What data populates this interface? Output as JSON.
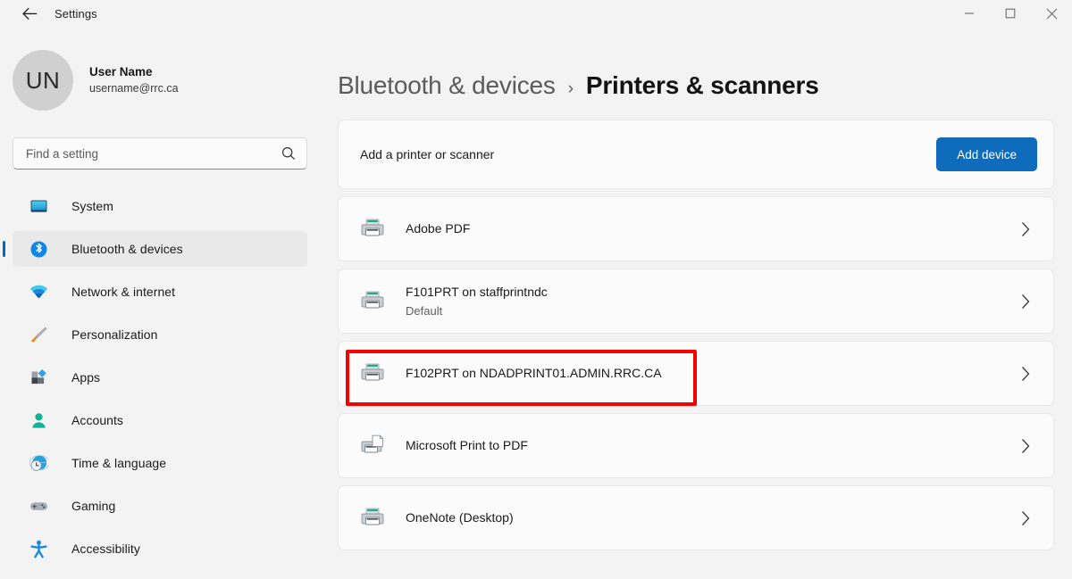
{
  "window": {
    "title": "Settings",
    "back_icon": "back-arrow-icon",
    "controls": [
      {
        "name": "minimize-button",
        "icon": "minimize-icon"
      },
      {
        "name": "maximize-button",
        "icon": "maximize-icon"
      },
      {
        "name": "close-button",
        "icon": "close-icon"
      }
    ]
  },
  "sidebar": {
    "account": {
      "initials": "UN",
      "name": "User Name",
      "email": "username@rrc.ca"
    },
    "search": {
      "placeholder": "Find a setting",
      "value": "",
      "icon": "search-icon"
    },
    "items": [
      {
        "label": "System",
        "icon": "system-icon",
        "active": false
      },
      {
        "label": "Bluetooth & devices",
        "icon": "bluetooth-icon",
        "active": true
      },
      {
        "label": "Network & internet",
        "icon": "wifi-icon",
        "active": false
      },
      {
        "label": "Personalization",
        "icon": "paintbrush-icon",
        "active": false
      },
      {
        "label": "Apps",
        "icon": "apps-icon",
        "active": false
      },
      {
        "label": "Accounts",
        "icon": "person-icon",
        "active": false
      },
      {
        "label": "Time & language",
        "icon": "clock-globe-icon",
        "active": false
      },
      {
        "label": "Gaming",
        "icon": "gamepad-icon",
        "active": false
      },
      {
        "label": "Accessibility",
        "icon": "accessibility-icon",
        "active": false
      }
    ]
  },
  "breadcrumb": {
    "parent": "Bluetooth & devices",
    "separator": "›",
    "current": "Printers & scanners"
  },
  "add_device": {
    "label": "Add a printer or scanner",
    "button_label": "Add device"
  },
  "printers": [
    {
      "name": "Adobe PDF",
      "status": "",
      "icon": "printer-icon",
      "highlighted": false
    },
    {
      "name": "F101PRT on staffprintndc",
      "status": "Default",
      "icon": "printer-icon",
      "highlighted": false
    },
    {
      "name": "F102PRT on NDADPRINT01.ADMIN.RRC.CA",
      "status": "",
      "icon": "printer-icon",
      "highlighted": true
    },
    {
      "name": "Microsoft Print to PDF",
      "status": "",
      "icon": "printer-document-icon",
      "highlighted": false
    },
    {
      "name": "OneNote (Desktop)",
      "status": "",
      "icon": "printer-icon",
      "highlighted": false
    }
  ],
  "colors": {
    "accent": "#0f6cbd",
    "accent_indicator": "#0067c0",
    "highlight": "#f80000",
    "page_bg": "#f3f3f3",
    "card_bg": "#fbfbfb"
  }
}
